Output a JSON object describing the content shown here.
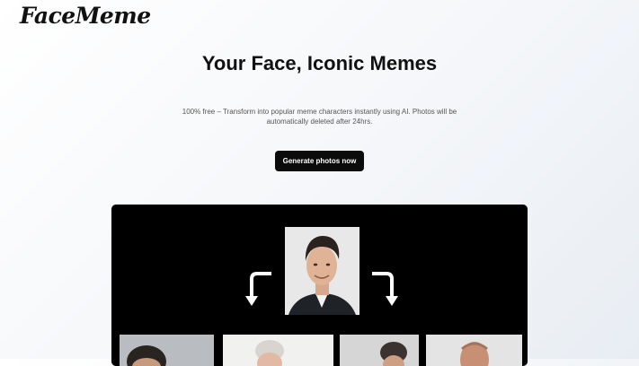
{
  "header": {
    "logo": "FaceMeme"
  },
  "hero": {
    "title": "Your Face, Iconic Memes",
    "subtitle": "100% free – Transform into popular meme characters instantly using AI. Photos will be automatically deleted after 24hrs.",
    "cta_label": "Generate photos now"
  },
  "demo": {
    "source_photo": "portrait-photo",
    "arrow_left_icon": "curved-arrow-down-left-icon",
    "arrow_right_icon": "curved-arrow-down-right-icon",
    "result_photos": [
      "meme-result-photo-1",
      "meme-result-photo-2",
      "meme-result-photo-3",
      "meme-result-photo-4"
    ]
  },
  "colors": {
    "accent": "#0b0b0c",
    "demo_background": "#000000",
    "page_background": "#f4f6f9"
  }
}
